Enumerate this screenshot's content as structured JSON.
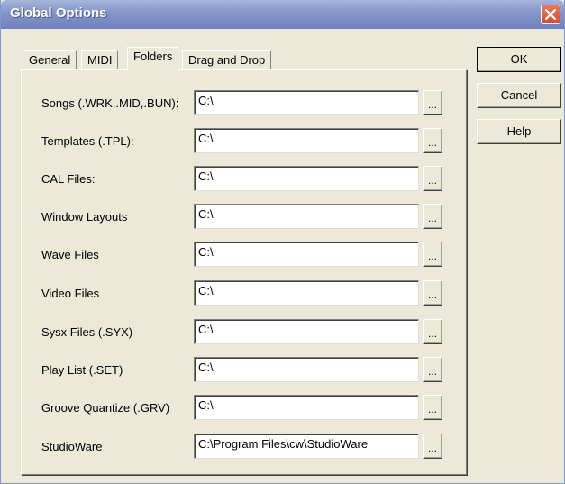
{
  "window": {
    "title": "Global Options"
  },
  "tabs": [
    {
      "label": "General"
    },
    {
      "label": "MIDI"
    },
    {
      "label": "Folders"
    },
    {
      "label": "Drag and Drop"
    }
  ],
  "active_tab": "Folders",
  "folders": [
    {
      "label": "Songs (.WRK,.MID,.BUN):",
      "value": "C:\\"
    },
    {
      "label": "Templates (.TPL):",
      "value": "C:\\"
    },
    {
      "label": "CAL Files:",
      "value": "C:\\"
    },
    {
      "label": "Window Layouts",
      "value": "C:\\"
    },
    {
      "label": "Wave Files",
      "value": "C:\\"
    },
    {
      "label": "Video Files",
      "value": "C:\\"
    },
    {
      "label": "Sysx Files (.SYX)",
      "value": "C:\\"
    },
    {
      "label": "Play List (.SET)",
      "value": "C:\\"
    },
    {
      "label": "Groove Quantize (.GRV)",
      "value": "C:\\"
    },
    {
      "label": "StudioWare",
      "value": "C:\\Program Files\\cw\\StudioWare"
    }
  ],
  "browse_label": "...",
  "buttons": {
    "ok": "OK",
    "cancel": "Cancel",
    "help": "Help"
  },
  "icons": {
    "close": "close-icon"
  },
  "colors": {
    "titlebar": "#8394c9",
    "close": "#d3502c",
    "face": "#ECE9D8"
  }
}
